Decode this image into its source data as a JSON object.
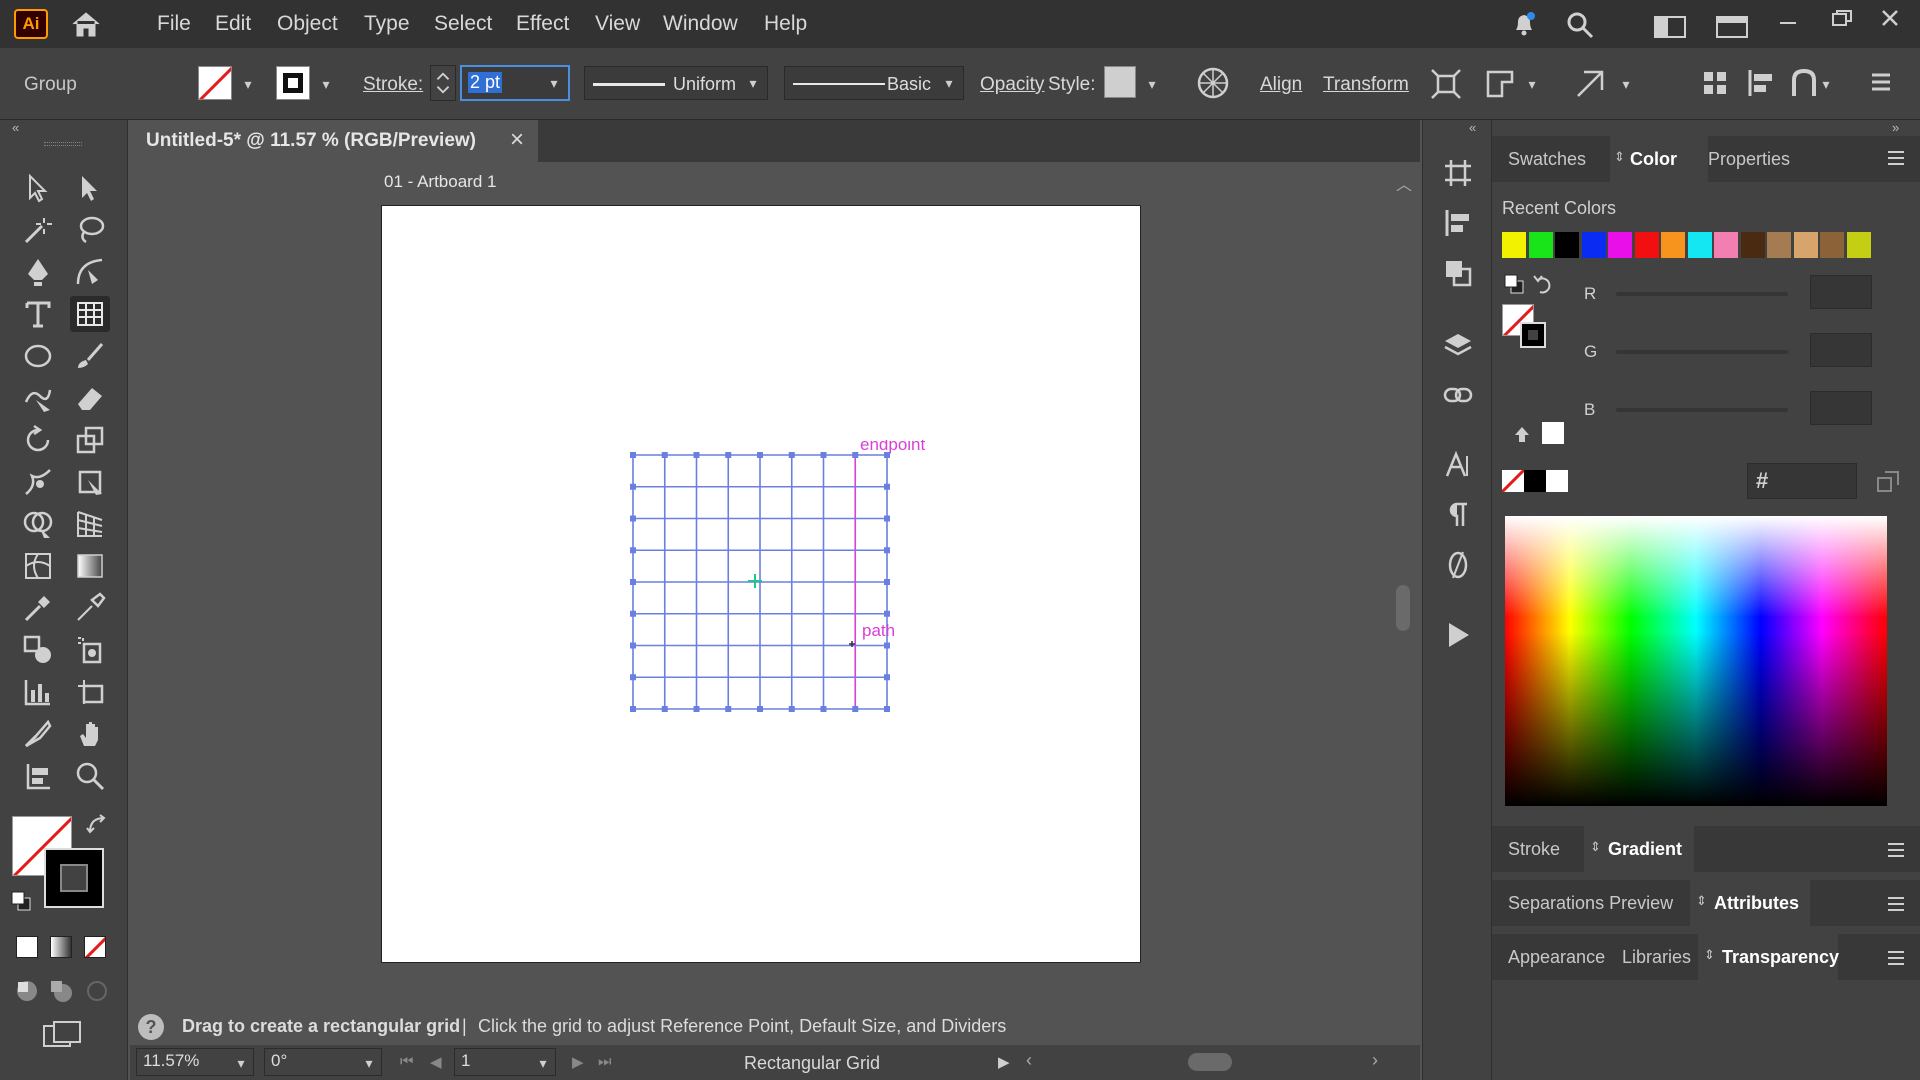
{
  "app": {
    "logo": "Ai"
  },
  "menu": [
    "File",
    "Edit",
    "Object",
    "Type",
    "Select",
    "Effect",
    "View",
    "Window",
    "Help"
  ],
  "control_bar": {
    "selection_type": "Group",
    "stroke_label": "Stroke:",
    "stroke_value": "2 pt",
    "stroke_profile": "Uniform",
    "brush": "Basic",
    "opacity_label": "Opacity",
    "style_label": "Style:",
    "align_label": "Align",
    "transform_label": "Transform"
  },
  "document": {
    "tab_title": "Untitled-5* @ 11.57 % (RGB/Preview)",
    "close_glyph": "×",
    "artboard_label": "01 - Artboard 1",
    "smart_guides": {
      "endpoint": "endpoint",
      "path": "path"
    }
  },
  "grid": {
    "columns": 8,
    "rows": 8,
    "stroke_color": "#6b7fe0",
    "highlight_color": "#d93fd9"
  },
  "right_panel": {
    "tabs": [
      "Swatches",
      "Color",
      "Properties"
    ],
    "active_tab": "Color",
    "recent_colors_label": "Recent Colors",
    "recent_colors": [
      "#f2f200",
      "#19e319",
      "#000000",
      "#0a2bf2",
      "#e80fe8",
      "#f20f0f",
      "#f7941d",
      "#14e6f2",
      "#f27eb2",
      "#4a2a10",
      "#a57c52",
      "#d7a56b",
      "#8c6238",
      "#c4cf14"
    ],
    "channels": [
      "R",
      "G",
      "B"
    ],
    "hex_symbol": "#",
    "groups": [
      {
        "tabs": [
          "Stroke",
          "Gradient"
        ],
        "active": "Gradient"
      },
      {
        "tabs": [
          "Separations Preview",
          "Attributes"
        ],
        "active": "Attributes"
      },
      {
        "tabs": [
          "Appearance",
          "Libraries",
          "Transparency"
        ],
        "active": "Transparency"
      }
    ]
  },
  "status": {
    "hint_prefix": "Drag to create a rectangular grid",
    "separator": "|",
    "hint_suffix": "Click the grid to adjust Reference Point, Default Size, and Dividers"
  },
  "bottom_bar": {
    "zoom": "11.57%",
    "rotation": "0°",
    "artboard_number": "1",
    "current_tool": "Rectangular Grid"
  }
}
